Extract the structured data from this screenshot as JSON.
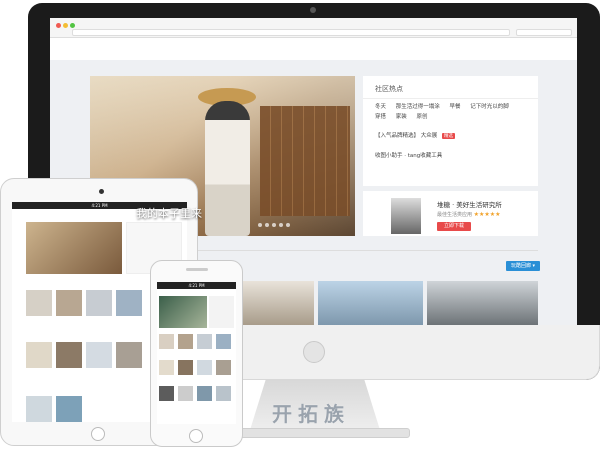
{
  "desktop": {
    "banner": {
      "title": "我的本子里来",
      "slide_count": 5,
      "active_slide": 1
    },
    "hot": {
      "title": "社区热点",
      "tags": [
        "冬天",
        "那生活过得一塌涂",
        "早餐",
        "记下时光以的脚",
        "穿搭",
        "家装",
        "原创"
      ],
      "feature_prefix": "【入气品牌精选】",
      "feature_text": "大众展",
      "feature_badge": "精选",
      "feature2": "收图小助手 · tang收藏工具"
    },
    "app": {
      "name": "堆糖 · 美好生活研究所",
      "subtitle": "最佳生活类应用",
      "rating_stars": 5,
      "stars": "★★★★★",
      "download_label": "立即下载"
    },
    "filter_label": "玩酷回廊 ▾"
  },
  "tablet": {
    "status": "4:21 PM"
  },
  "phone": {
    "status": "4:21 PM"
  },
  "watermark": "开拓族",
  "colors": {
    "accent_red": "#e84a4a",
    "accent_blue": "#2a8fd6",
    "star": "#f1a22a"
  },
  "icons": {
    "browser_dots": "traffic-light-icons",
    "home_button": "home-button-icon"
  }
}
